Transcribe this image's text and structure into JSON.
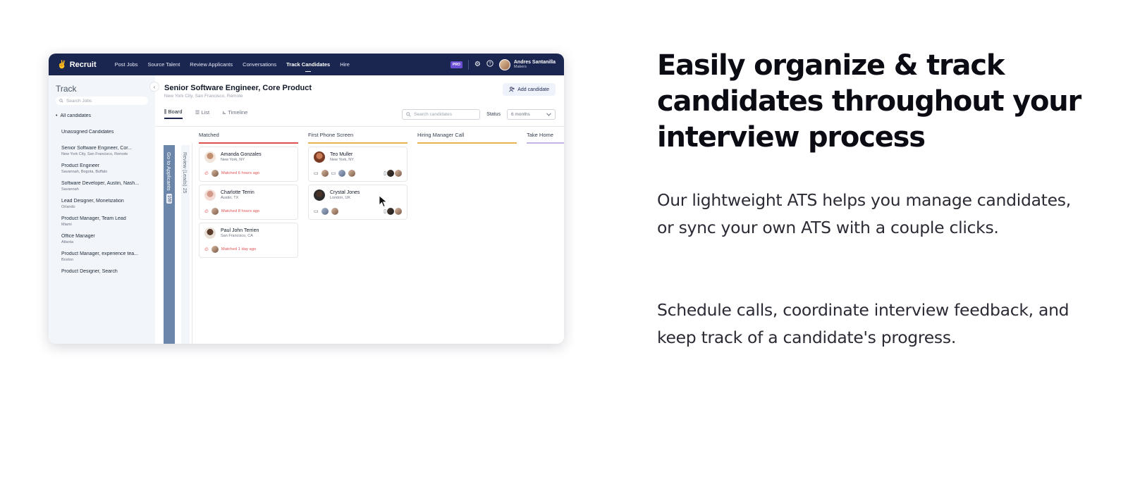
{
  "app": {
    "brand": "Recruit",
    "nav": [
      "Post Jobs",
      "Source Talent",
      "Review Applicants",
      "Conversations",
      "Track Candidates",
      "Hire"
    ],
    "nav_active_index": 4,
    "pro_badge": "PRO",
    "user": {
      "name": "Andres Santanilla",
      "org": "Makers"
    }
  },
  "sidebar": {
    "title": "Track",
    "search_placeholder": "Search Jobs",
    "all_label": "All candidates",
    "unassigned_label": "Unassigned Candidates",
    "jobs": [
      {
        "title": "Senior Software Engineer, Cor...",
        "location": "New York City, San Francisco, Remote"
      },
      {
        "title": "Product Engineer",
        "location": "Savannah, Bogota, Buffalo"
      },
      {
        "title": "Software Developer, Austin, Nash...",
        "location": "Savannah"
      },
      {
        "title": "Lead Designer, Monetization",
        "location": "Orlando"
      },
      {
        "title": "Product Manager, Team Lead",
        "location": "Miami"
      },
      {
        "title": "Office Manager",
        "location": "Atlanta"
      },
      {
        "title": "Product Manager, experience tea...",
        "location": "Boston"
      },
      {
        "title": "Product Designer, Search",
        "location": ""
      }
    ]
  },
  "main": {
    "job_title": "Senior Software Engineer, Core Product",
    "job_location": "New York City, San Francisco, Remote",
    "add_candidate": "Add candidate",
    "views": [
      "Board",
      "List",
      "Timeline"
    ],
    "search_placeholder": "Search candidates",
    "status_label": "Status",
    "status_value": "6 months",
    "go_to_applicants": "Go to Applicants",
    "go_to_applicants_count": "100",
    "review_leads": "Review (Leads)",
    "review_leads_count": "25",
    "columns": [
      {
        "name": "Matched",
        "cards": [
          {
            "name": "Amanda Gonzales",
            "location": "New York, NY",
            "status": "Matched 6 hours ago"
          },
          {
            "name": "Charlotte Terrin",
            "location": "Austin, TX",
            "status": "Matched 8 hours ago"
          },
          {
            "name": "Paul John Terrien",
            "location": "San Francisco, CA",
            "status": "Matched 1 day ago"
          }
        ]
      },
      {
        "name": "First Phone Screen",
        "cards": [
          {
            "name": "Teo Muller",
            "location": "New York, NY"
          },
          {
            "name": "Crystal Jones",
            "location": "London, UK"
          }
        ]
      },
      {
        "name": "Hiring Manager Call",
        "cards": []
      },
      {
        "name": "Take Home",
        "cards": []
      }
    ]
  },
  "marketing": {
    "headline": "Easily organize & track candidates throughout your interview process",
    "paragraph1": "Our lightweight ATS helps you manage candidates, or sync your own ATS with a couple clicks.",
    "paragraph2": "Schedule calls, coordinate interview feedback, and keep track of a candidate's progress."
  },
  "colors": {
    "topbar": "#1a2550",
    "matched_accent": "#e05252",
    "phone_screen_accent": "#e7b352",
    "take_home_accent": "#c5b3e6",
    "sidebar_bg": "#f2f6fb"
  },
  "icons": [
    "logo-icon",
    "settings-icon",
    "help-icon",
    "search-icon",
    "collapse-chevron-icon",
    "add-user-icon",
    "board-icon",
    "list-icon",
    "timeline-icon",
    "chevron-down-icon",
    "flame-icon",
    "calendar-icon",
    "document-icon",
    "cursor-icon"
  ]
}
